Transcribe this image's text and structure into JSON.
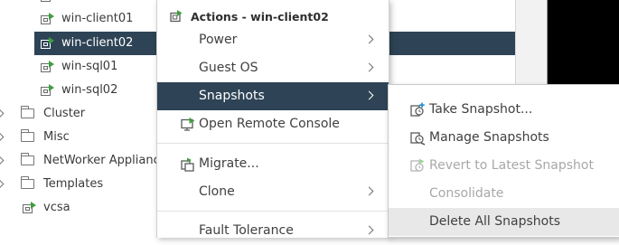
{
  "tree": {
    "items": [
      {
        "label": "win-client01",
        "kind": "vm"
      },
      {
        "label": "win-client02",
        "kind": "vm",
        "selected": true
      },
      {
        "label": "win-sql01",
        "kind": "vm"
      },
      {
        "label": "win-sql02",
        "kind": "vm"
      },
      {
        "label": "Cluster",
        "kind": "folder"
      },
      {
        "label": "Misc",
        "kind": "folder"
      },
      {
        "label": "NetWorker Applianc",
        "kind": "folder"
      },
      {
        "label": "Templates",
        "kind": "folder"
      },
      {
        "label": "vcsa",
        "kind": "vm"
      }
    ]
  },
  "menu": {
    "header": "Actions - win-client02",
    "items": [
      {
        "label": "Power",
        "submenu": true
      },
      {
        "label": "Guest OS",
        "submenu": true
      },
      {
        "label": "Snapshots",
        "submenu": true,
        "active": true
      },
      {
        "label": "Open Remote Console",
        "icon": "remote-console-icon"
      },
      {
        "label": "Migrate...",
        "icon": "migrate-icon"
      },
      {
        "label": "Clone",
        "submenu": true
      },
      {
        "label": "Fault Tolerance",
        "submenu": true
      }
    ]
  },
  "submenu": {
    "items": [
      {
        "label": "Take Snapshot...",
        "icon": "take-snapshot-icon",
        "enabled": true
      },
      {
        "label": "Manage Snapshots",
        "icon": "manage-snapshots-icon",
        "enabled": true
      },
      {
        "label": "Revert to Latest Snapshot",
        "icon": "revert-snapshot-icon",
        "enabled": false
      },
      {
        "label": "Consolidate",
        "enabled": false
      },
      {
        "label": "Delete All Snapshots",
        "enabled": true,
        "hover": true
      }
    ]
  },
  "colors": {
    "accent": "#2e4456",
    "vm_power_on": "#3f9e3f",
    "disabled_text": "#a8a8a8"
  }
}
